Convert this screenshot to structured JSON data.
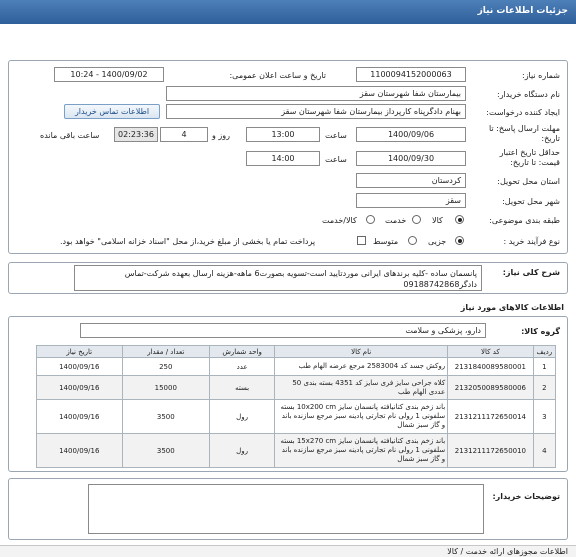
{
  "header": {
    "title": "جزئیات اطلاعات نیاز"
  },
  "form": {
    "need_number": {
      "label": "شماره نیاز:",
      "value": "1100094152000063"
    },
    "announce_datetime": {
      "label": "تاریخ و ساعت اعلان عمومی:",
      "value": "1400/09/02 - 10:24"
    },
    "buyer_org": {
      "label": "نام دستگاه خریدار:",
      "value": "بیمارستان شفا شهرستان سقز"
    },
    "requester": {
      "label": "ایجاد کننده درخواست:",
      "value": "بهنام دادگرپناه کارپرداز بیمارستان شفا شهرستان سقز"
    },
    "contact_button": "اطلاعات تماس خریدار",
    "deadline": {
      "label": "مهلت ارسال پاسخ: تا تاریخ:",
      "date": "1400/09/06",
      "time_label": "ساعت",
      "time": "13:00",
      "days": "4",
      "days_label": "روز و",
      "remaining": "02:23:36",
      "remaining_label": "ساعت باقی مانده"
    },
    "price_validity": {
      "label": "حداقل تاریخ اعتبار قیمت: تا تاریخ:",
      "date": "1400/09/30",
      "time_label": "ساعت",
      "time": "14:00"
    },
    "province": {
      "label": "استان محل تحویل:",
      "value": "کردستان"
    },
    "city": {
      "label": "شهر محل تحویل:",
      "value": "سقز"
    },
    "category": {
      "label": "طبقه بندی موضوعی:",
      "options": [
        "کالا",
        "خدمت",
        "کالا/خدمت"
      ],
      "selected": "کالا"
    },
    "purchase_process": {
      "label": "نوع فرآیند خرید :",
      "options": [
        "جزیی",
        "متوسط"
      ],
      "selected": "جزیی",
      "treasury_note": "پرداخت تمام یا بخشی از مبلغ خرید،از محل \"اسناد خزانه اسلامی\" خواهد بود."
    }
  },
  "need_description": {
    "label": "شرح کلی نیاز:",
    "text": "پانسمان ساده -کلیه برندهای ایرانی موردتایید است-تسویه بصورت6 ماهه-هزینه ارسال بعهده شرکت-تماس دادگر09188742868"
  },
  "goods_section": {
    "title": "اطلاعات کالاهای مورد نیاز",
    "group_label": "گروه کالا:",
    "group_value": "دارو، پزشکی و سلامت"
  },
  "table": {
    "headers": [
      "ردیف",
      "کد کالا",
      "نام کالا",
      "واحد شمارش",
      "تعداد / مقدار",
      "تاریخ نیاز"
    ],
    "rows": [
      {
        "row": "1",
        "code": "2131840089580001",
        "name": "روکش جسد کد 2583004 مرجع عرضه الهام طب",
        "unit": "عدد",
        "qty": "250",
        "date": "1400/09/16"
      },
      {
        "row": "2",
        "code": "2132050089580006",
        "name": "کلاه جراحی سایز فری سایز کد 4351 بسته بندی 50 عددی الهام طب",
        "unit": "بسته",
        "qty": "15000",
        "date": "1400/09/16"
      },
      {
        "row": "3",
        "code": "2131211172650014",
        "name": "باند زخم بندی کتانیافته پانسمان سایز 10x200 cm بسته سلفونی 1 رولی نام تجارتی پادینه سبز مرجع سازنده باند و گاز سبز شمال",
        "unit": "رول",
        "qty": "3500",
        "date": "1400/09/16"
      },
      {
        "row": "4",
        "code": "2131211172650010",
        "name": "باند زخم بندی کتانیافته پانسمان سایز 15x270 cm بسته سلفونی 1 رولی نام تجارتی پادینه سبز مرجع سازنده باند و گاز سبز شمال",
        "unit": "رول",
        "qty": "3500",
        "date": "1400/09/16"
      }
    ]
  },
  "buyer_notes": {
    "label": "توضیحات خریدار:",
    "value": ""
  },
  "footer": {
    "text": "اطلاعات مجوزهای ارائه خدمت / کالا"
  },
  "colors": {
    "header": "#3a6ba6",
    "link": "#1d4f8c",
    "border": "#9aa7b3"
  }
}
